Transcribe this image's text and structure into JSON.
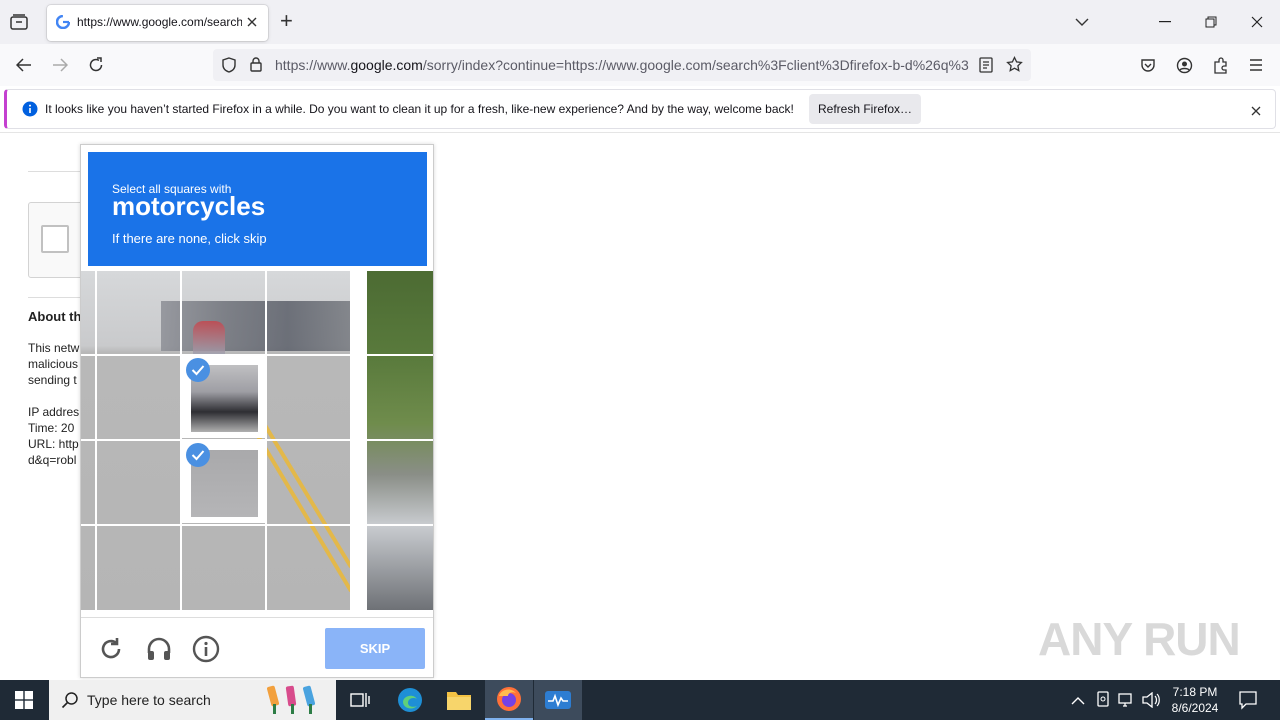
{
  "browser": {
    "tab_title": "https://www.google.com/search",
    "new_tab_symbol": "+",
    "url_host_prefix": "https://www.",
    "url_host": "google.com",
    "url_rest": "/sorry/index?continue=https://www.google.com/search%3Fclient%3Dfirefox-b-d%26q%3D"
  },
  "notification": {
    "message": "It looks like you haven’t started Firefox in a while. Do you want to clean it up for a fresh, like-new experience? And by the way, welcome back!",
    "button_label": "Refresh Firefox…"
  },
  "page": {
    "about_heading": "About th",
    "lines": [
      "This netw",
      "malicious",
      "sending t"
    ],
    "ip_line": "IP addres",
    "time_line": "Time: 20",
    "url_line": "URL: http",
    "url_line2": "d&q=robl"
  },
  "captcha": {
    "instruction_small": "Select all squares with",
    "target_word": "motorcycles",
    "instruction_sub": "If there are none, click skip",
    "skip_label": "SKIP",
    "selected_tiles": 2
  },
  "taskbar": {
    "search_placeholder": "Type here to search",
    "time": "7:18 PM",
    "date": "8/6/2024"
  },
  "watermark": "ANY RUN",
  "colors": {
    "captcha_header": "#1a73e8",
    "skip_button": "#8ab4f8",
    "taskbar": "#1f2a36"
  },
  "icons": [
    "tab-list-icon",
    "google-favicon",
    "close-tab-icon",
    "new-tab-icon",
    "chevron-down-icon",
    "minimize-icon",
    "restore-icon",
    "close-window-icon",
    "back-icon",
    "forward-icon",
    "reload-icon",
    "shield-icon",
    "lock-icon",
    "reader-icon",
    "bookmark-star-icon",
    "pocket-icon",
    "account-icon",
    "extensions-icon",
    "menu-icon",
    "info-icon",
    "close-icon",
    "reload-captcha-icon",
    "headphones-icon",
    "info-circle-icon",
    "windows-start-icon",
    "search-icon",
    "task-view-icon",
    "edge-icon",
    "file-explorer-icon",
    "firefox-icon",
    "anyrun-icon"
  ]
}
